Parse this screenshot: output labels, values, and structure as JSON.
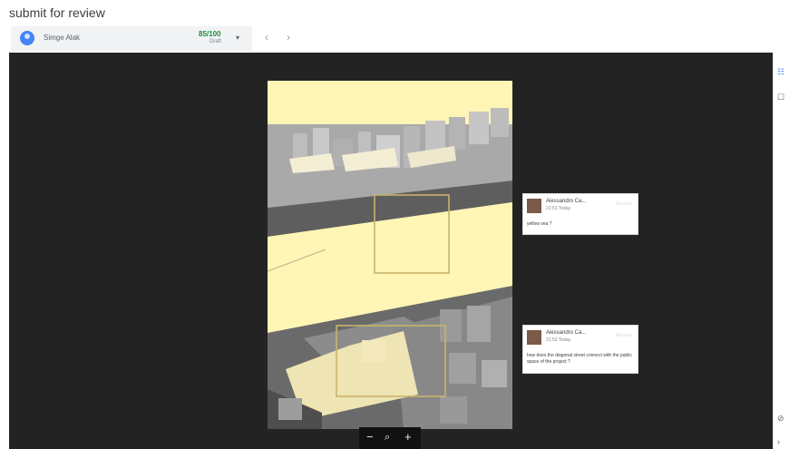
{
  "header": {
    "title": "submit for review"
  },
  "student": {
    "name": "Simge Alak",
    "grade": "85/100",
    "status": "Draft",
    "dropdown_icon": "▾"
  },
  "nav": {
    "prev": "‹",
    "next": "›"
  },
  "rail": {
    "icon1": "☷",
    "icon2": "☐",
    "icon3": "⊘",
    "icon4": "›"
  },
  "comments": [
    {
      "author": "Alessandro Ca...",
      "time": "21:51 Today",
      "resolve": "Resolve",
      "text": "yellow sea ?"
    },
    {
      "author": "Alessandro Ca...",
      "time": "21:52 Today",
      "resolve": "Resolve",
      "text": "how does the diagonal street connect with the public space of the project ?"
    }
  ],
  "zoom": {
    "out": "−",
    "icon": "⌕",
    "in": "+"
  },
  "colors": {
    "sea": "#fff5b5",
    "viewer_bg": "#232323",
    "grade": "#1e8e3e",
    "highlight": "#c8b46a"
  }
}
